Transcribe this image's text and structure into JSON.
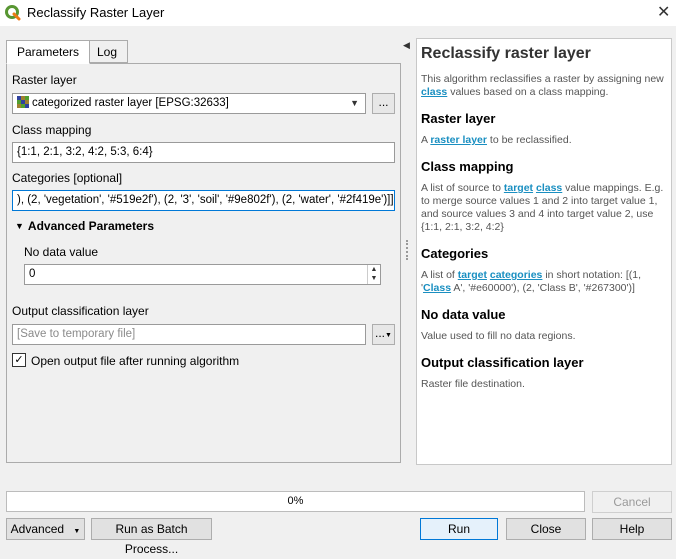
{
  "window": {
    "title": "Reclassify Raster Layer",
    "close_symbol": "✕"
  },
  "tabs": [
    {
      "label": "Parameters"
    },
    {
      "label": "Log"
    }
  ],
  "params": {
    "raster_layer_label": "Raster layer",
    "raster_layer_value": "categorized raster layer [EPSG:32633]",
    "browse_label": "...",
    "class_mapping_label": "Class mapping",
    "class_mapping_value": "{1:1, 2:1, 3:2, 4:2, 5:3, 6:4}",
    "categories_label": "Categories [optional]",
    "categories_value": "), (2, 'vegetation', '#519e2f'), (2, '3', 'soil', '#9e802f'), (2, 'water', '#2f419e')]]",
    "advanced_label": "Advanced Parameters",
    "nodata_label": "No data value",
    "nodata_value": "0",
    "output_label": "Output classification layer",
    "output_placeholder": "[Save to temporary file]",
    "output_browse_label": "...",
    "open_output_label": "Open output file after running algorithm",
    "open_output_checked": "✓"
  },
  "help": {
    "title": "Reclassify raster layer",
    "intro": [
      "This algorithm reclassifies a raster by assigning new ",
      "class",
      " values based on a class mapping."
    ],
    "raster_heading": "Raster layer",
    "raster_desc": [
      "A ",
      "raster layer",
      " to be reclassified."
    ],
    "mapping_heading": "Class mapping",
    "mapping_desc": [
      "A list of source to ",
      "target",
      " ",
      "class",
      " value mappings. E.g. to merge source values 1 and 2 into target value 1, and source values 3 and 4 into target value 2, use {1:1, 2:1, 3:2, 4:2}"
    ],
    "categories_heading": "Categories",
    "categories_desc": [
      "A list of ",
      "target",
      " ",
      "categories",
      " in short notation: [(1, '",
      "Class",
      " A', '#e60000'), (2, 'Class B', '#267300')]"
    ],
    "nodata_heading": "No data value",
    "nodata_desc": "Value used to fill no data regions.",
    "output_heading": "Output classification layer",
    "output_desc": "Raster file destination."
  },
  "progress": {
    "text": "0%",
    "value": 0
  },
  "buttons": {
    "cancel": "Cancel",
    "advanced": "Advanced",
    "batch": "Run as Batch Process...",
    "run": "Run",
    "close": "Close",
    "help": "Help"
  },
  "colors": {
    "link": "#1a8fc1",
    "qgis_green": "#589632",
    "qgis_yellow": "#ee7913"
  }
}
